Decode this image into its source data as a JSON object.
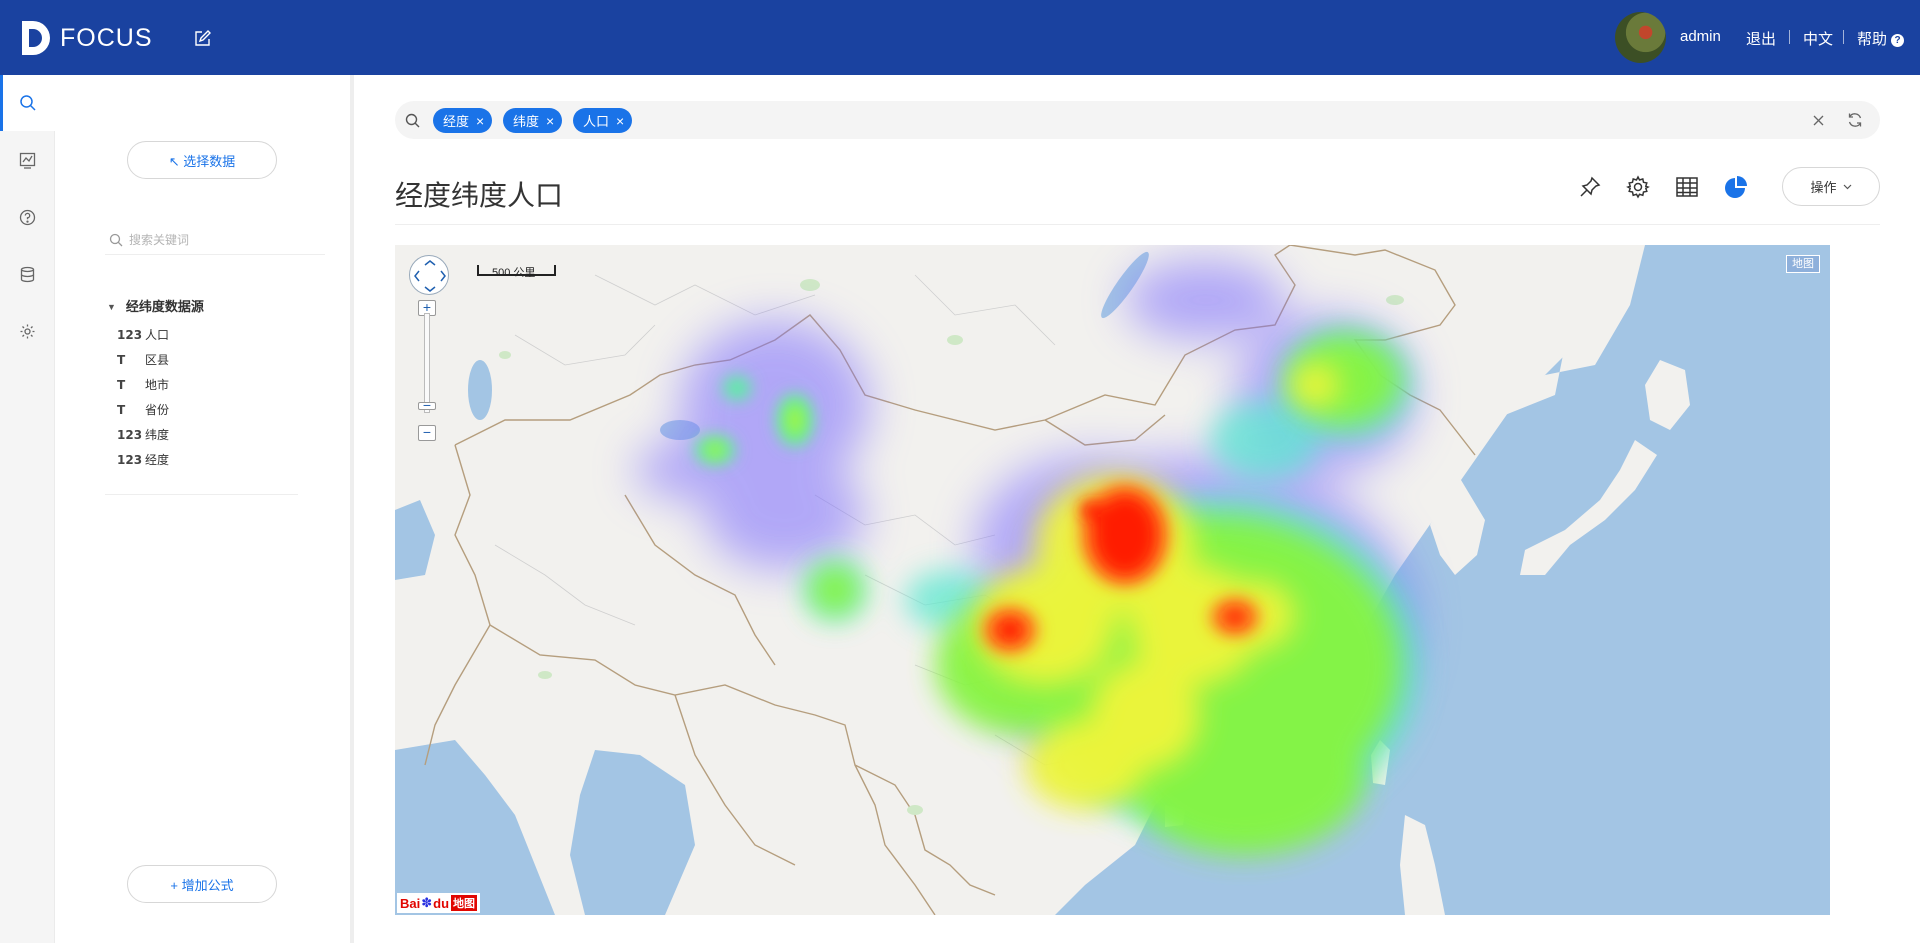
{
  "header": {
    "logo_text": "FOCUS",
    "username": "admin",
    "logout": "退出",
    "language": "中文",
    "help": "帮助"
  },
  "rail": {
    "items": [
      {
        "icon": "search-icon",
        "active": true
      },
      {
        "icon": "chart-board-icon",
        "active": false
      },
      {
        "icon": "question-icon",
        "active": false
      },
      {
        "icon": "database-icon",
        "active": false
      },
      {
        "icon": "gear-icon",
        "active": false
      }
    ]
  },
  "panel": {
    "select_data_button": "↖ 选择数据",
    "search_placeholder": "搜索关键词",
    "source_name": "经纬度数据源",
    "fields": [
      {
        "type": "123",
        "name": "人口"
      },
      {
        "type": "T",
        "name": "区县"
      },
      {
        "type": "T",
        "name": "地市"
      },
      {
        "type": "T",
        "name": "省份"
      },
      {
        "type": "123",
        "name": "纬度"
      },
      {
        "type": "123",
        "name": "经度"
      }
    ],
    "add_formula_button": "+ 增加公式"
  },
  "search": {
    "tags": [
      "经度",
      "纬度",
      "人口"
    ]
  },
  "result": {
    "title": "经度纬度人口",
    "operations_button": "操作"
  },
  "map": {
    "scale_label": "500 公里",
    "map_type_button": "地图",
    "provider_logo": "Baidu地图",
    "heat_colors": {
      "low": "#7b6cff",
      "mid_low": "#4ff0b0",
      "mid": "#7cf542",
      "high": "#f5f53a",
      "peak": "#ff1a00"
    }
  },
  "colors": {
    "topbar": "#1a42a0",
    "accent": "#1a73e8",
    "land": "#f2f1ee",
    "water": "#a3c5e4"
  }
}
